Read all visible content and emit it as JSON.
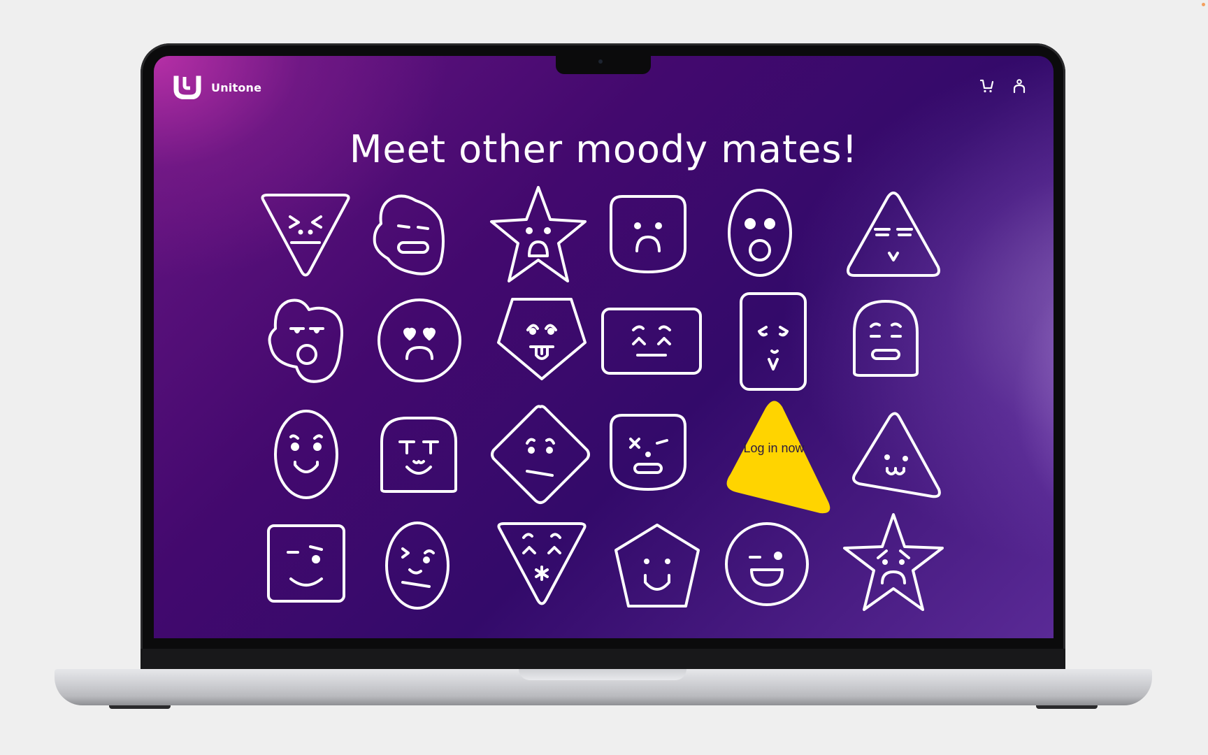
{
  "app": {
    "brand_name": "Unitone",
    "headline": "Meet other moody mates!",
    "cta_label": "Log in now",
    "icons": [
      "cart-icon",
      "user-icon"
    ]
  },
  "colors": {
    "background": "#efefef",
    "gradient_start": "#6a1684",
    "gradient_mid": "#330a6a",
    "cta_fill": "#ffd400",
    "outline": "#ffffff"
  },
  "faces": [
    {
      "shape": "triangle-down",
      "mood": "angry"
    },
    {
      "shape": "blob",
      "mood": "unimpressed"
    },
    {
      "shape": "star",
      "mood": "surprised"
    },
    {
      "shape": "rounded-square",
      "mood": "sad"
    },
    {
      "shape": "oval",
      "mood": "shocked"
    },
    {
      "shape": "triangle",
      "mood": "sleepy"
    },
    {
      "shape": "blob",
      "mood": "shouting"
    },
    {
      "shape": "circle",
      "mood": "lovesick"
    },
    {
      "shape": "pentagon-inverted",
      "mood": "silly"
    },
    {
      "shape": "wide-rectangle",
      "mood": "content"
    },
    {
      "shape": "tall-rectangle",
      "mood": "kissy"
    },
    {
      "shape": "rounded-blob",
      "mood": "meh"
    },
    {
      "shape": "oval",
      "mood": "mischievous"
    },
    {
      "shape": "rounded-square",
      "mood": "smug"
    },
    {
      "shape": "diamond",
      "mood": "doubtful"
    },
    {
      "shape": "rounded-square",
      "mood": "dizzy"
    },
    {
      "shape": "triangle-cta",
      "mood": "login"
    },
    {
      "shape": "triangle",
      "mood": "cute"
    },
    {
      "shape": "square",
      "mood": "smirk"
    },
    {
      "shape": "oval",
      "mood": "suspicious"
    },
    {
      "shape": "triangle-down",
      "mood": "ecstatic"
    },
    {
      "shape": "pentagon",
      "mood": "happy"
    },
    {
      "shape": "circle",
      "mood": "winking"
    },
    {
      "shape": "star",
      "mood": "worried"
    }
  ]
}
